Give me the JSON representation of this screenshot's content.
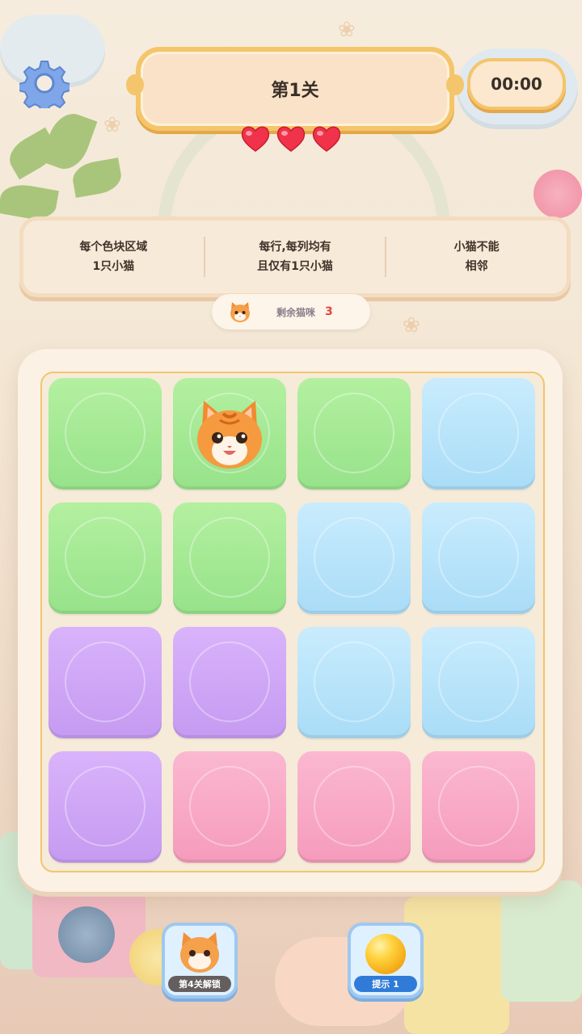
{
  "header": {
    "level_title": "第1关",
    "timer": "00:00",
    "hearts_count": 3
  },
  "rules": [
    {
      "line1": "每个色块区域",
      "line2": "1只小猫"
    },
    {
      "line1": "每行,每列均有",
      "line2": "且仅有1只小猫"
    },
    {
      "line1": "小猫不能",
      "line2": "相邻"
    }
  ],
  "remaining": {
    "label": "剩余猫咪",
    "count": "3"
  },
  "board": {
    "rows": [
      [
        "green",
        "green",
        "green",
        "blue"
      ],
      [
        "green",
        "green",
        "blue",
        "blue"
      ],
      [
        "purple",
        "purple",
        "blue",
        "blue"
      ],
      [
        "purple",
        "pink",
        "pink",
        "pink"
      ]
    ],
    "cats": [
      {
        "row": 0,
        "col": 1
      }
    ]
  },
  "items": {
    "unlock_label": "第4关解锁",
    "hint_label": "提示 1"
  },
  "colors": {
    "green": "#a6ea95",
    "blue": "#b9e3fa",
    "purple": "#cfa6f6",
    "pink": "#f8aac6",
    "accent_gold": "#f4c56a"
  },
  "icons": [
    "settings-gear-icon",
    "heart-icon",
    "cat-face-icon",
    "gold-ball-icon"
  ]
}
